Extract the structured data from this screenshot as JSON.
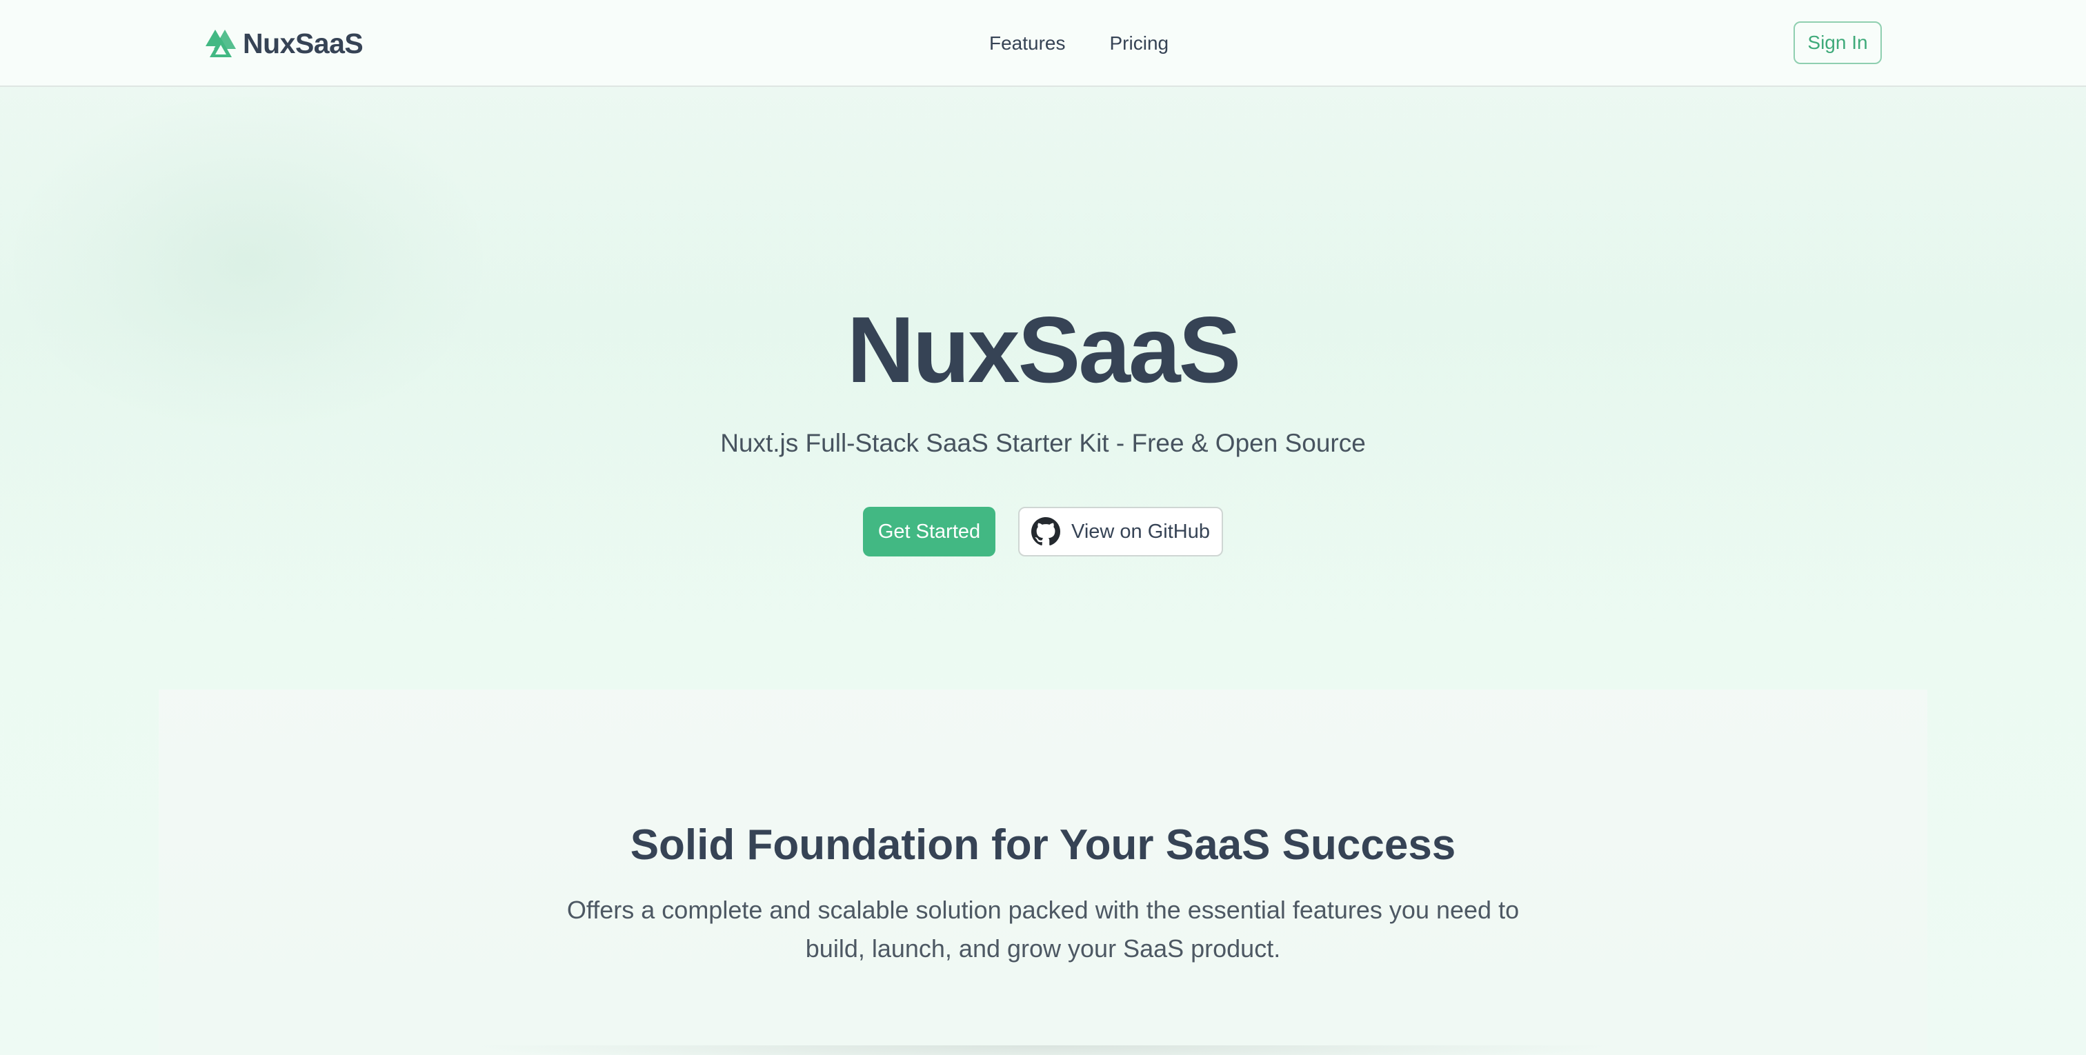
{
  "header": {
    "brand_name": "NuxSaaS",
    "logo_icon": "nuxt-triangle-logo-icon",
    "nav": [
      {
        "label": "Features"
      },
      {
        "label": "Pricing"
      }
    ],
    "sign_in_label": "Sign In"
  },
  "hero": {
    "title": "NuxSaaS",
    "subtitle": "Nuxt.js Full-Stack SaaS Starter Kit - Free & Open Source",
    "primary_button": "Get Started",
    "secondary_button": "View on GitHub",
    "secondary_icon": "github-icon"
  },
  "features": {
    "title": "Solid Foundation for Your SaaS Success",
    "description": "Offers a complete and scalable solution packed with the essential features you need to build, launch, and grow your SaaS product."
  },
  "colors": {
    "accent": "#42b883",
    "text_primary": "#364355",
    "background": "#e6f7ee"
  }
}
